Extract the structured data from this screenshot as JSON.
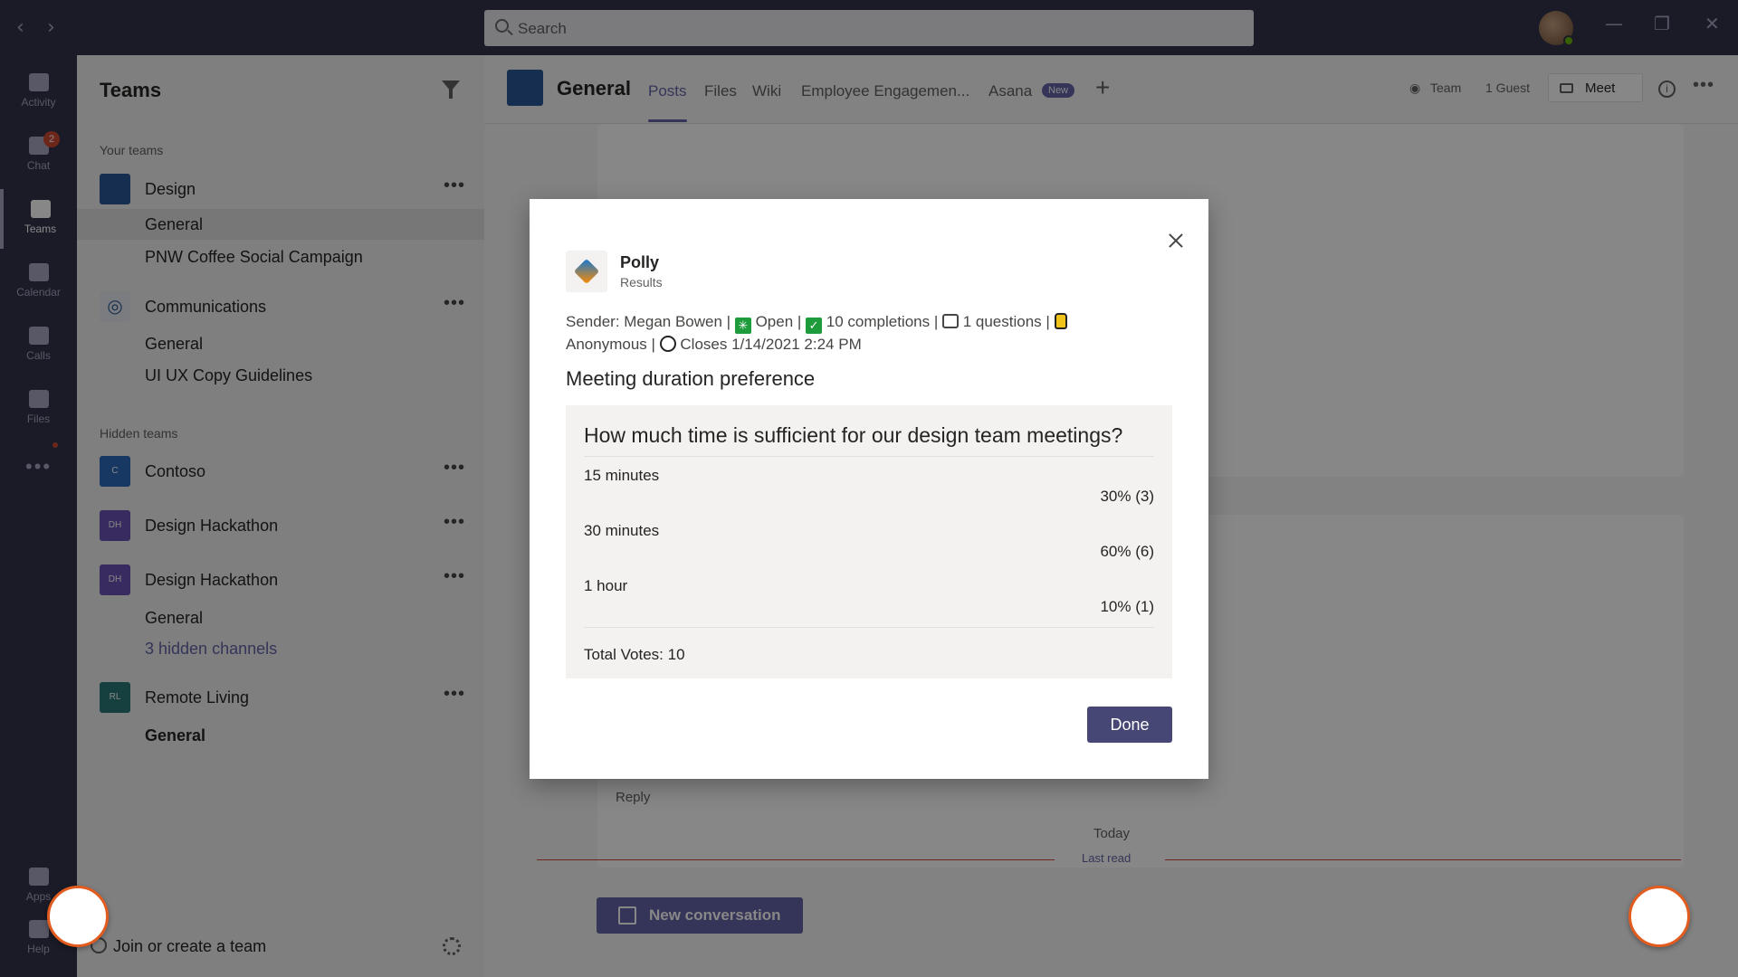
{
  "titlebar": {
    "search_placeholder": "Search",
    "back_icon": "‹",
    "forward_icon": "›",
    "minimize": "—",
    "restore": "❐",
    "close": "✕"
  },
  "rail": {
    "items": [
      {
        "label": "Activity",
        "icon": "bell-icon"
      },
      {
        "label": "Chat",
        "icon": "chat-icon",
        "badge": "2"
      },
      {
        "label": "Teams",
        "icon": "teams-icon"
      },
      {
        "label": "Calendar",
        "icon": "calendar-icon"
      },
      {
        "label": "Calls",
        "icon": "phone-icon"
      },
      {
        "label": "Files",
        "icon": "files-icon"
      },
      {
        "label": "Apps",
        "icon": "apps-icon"
      },
      {
        "label": "Help",
        "icon": "help-icon"
      }
    ],
    "more": "•••"
  },
  "teams_panel": {
    "title": "Teams",
    "your_teams_label": "Your teams",
    "hidden_teams_label": "Hidden teams",
    "teams": [
      {
        "name": "Design",
        "channels": [
          "General",
          "PNW Coffee Social Campaign"
        ]
      },
      {
        "name": "Communications",
        "channels": [
          "General",
          "UI UX Copy Guidelines"
        ]
      }
    ],
    "hidden": [
      {
        "name": "Contoso",
        "initials": "C"
      },
      {
        "name": "Design Hackathon",
        "initials": "DH"
      },
      {
        "name": "Design Hackathon",
        "initials": "DH",
        "channels": [
          "General",
          "3 hidden channels"
        ]
      },
      {
        "name": "Remote Living",
        "initials": "RL",
        "channels": [
          "General"
        ]
      }
    ],
    "join_label": "Join or create a team"
  },
  "channel_header": {
    "name": "General",
    "tabs": [
      "Posts",
      "Files",
      "Wiki",
      "Employee Engagemen...",
      "Asana"
    ],
    "new_badge": "New",
    "team_label": "Team",
    "guest_label": "1 Guest",
    "meet_label": "Meet"
  },
  "feed": {
    "reply_label": "Reply",
    "today_label": "Today",
    "last_read_label": "Last read",
    "new_conversation_label": "New conversation"
  },
  "dialog": {
    "bot_name": "Polly",
    "bot_subtitle": "Results",
    "meta": {
      "sender": "Sender: Megan Bowen |",
      "status": "Open |",
      "completions": "10 completions |",
      "questions": "1 questions |",
      "anonymous": "Anonymous |",
      "closes": "Closes 1/14/2021 2:24 PM"
    },
    "poll_title": "Meeting duration preference",
    "question": "How much time is sufficient for our design team meetings?",
    "options": [
      {
        "label": "15 minutes",
        "result": "30% (3)",
        "percent": 30
      },
      {
        "label": "30 minutes",
        "result": "60% (6)",
        "percent": 60
      },
      {
        "label": "1 hour",
        "result": "10% (1)",
        "percent": 10
      }
    ],
    "total_votes": "Total Votes: 10",
    "done_label": "Done"
  },
  "colors": {
    "titlebar": "#33344a",
    "accent": "#6264a7",
    "done_button": "#464775"
  }
}
